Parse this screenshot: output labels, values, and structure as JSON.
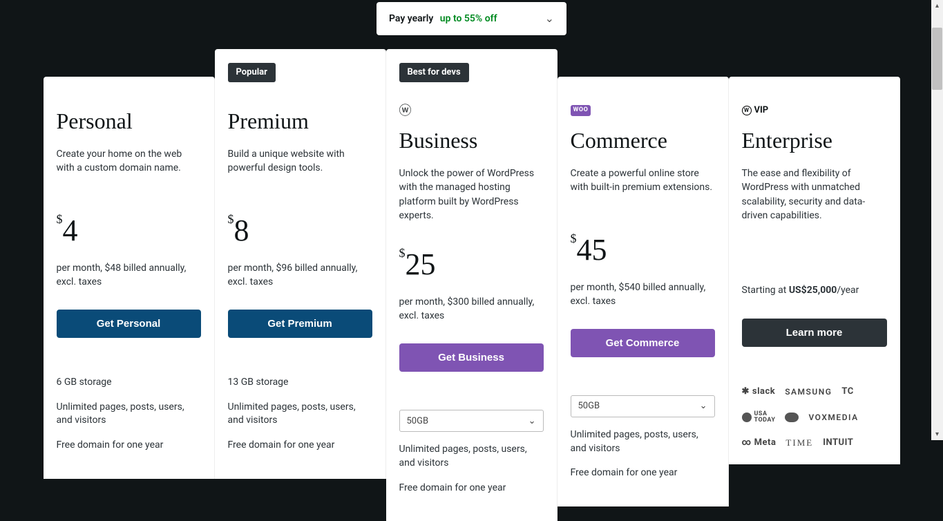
{
  "billing": {
    "label": "Pay yearly",
    "promo": "up to 55% off"
  },
  "plans": [
    {
      "title": "Personal",
      "desc": "Create your home on the web with a custom domain name.",
      "price": "4",
      "billing_note": "per month, $48 billed annually, excl. taxes",
      "button": "Get Personal",
      "features": [
        "6 GB storage",
        "Unlimited pages, posts, users, and visitors",
        "Free domain for one year"
      ]
    },
    {
      "badge": "Popular",
      "title": "Premium",
      "desc": "Build a unique website with powerful design tools.",
      "price": "8",
      "billing_note": "per month, $96 billed annually, excl. taxes",
      "button": "Get Premium",
      "features": [
        "13 GB storage",
        "Unlimited pages, posts, users, and visitors",
        "Free domain for one year"
      ]
    },
    {
      "badge": "Best for devs",
      "title": "Business",
      "desc": "Unlock the power of WordPress with the managed hosting platform built by WordPress experts.",
      "price": "25",
      "billing_note": "per month, $300 billed annually, excl. taxes",
      "button": "Get Business",
      "storage": "50GB",
      "features": [
        "Unlimited pages, posts, users, and visitors",
        "Free domain for one year"
      ]
    },
    {
      "title": "Commerce",
      "desc": "Create a powerful online store with built-in premium extensions.",
      "price": "45",
      "billing_note": "per month, $540 billed annually, excl. taxes",
      "button": "Get Commerce",
      "storage": "50GB",
      "features": [
        "Unlimited pages, posts, users, and visitors",
        "Free domain for one year"
      ]
    },
    {
      "title": "Enterprise",
      "desc": "The ease and flexibility of WordPress with unmatched scalability, security and data-driven capabilities.",
      "starting_prefix": "Starting at ",
      "starting_bold": "US$25,000",
      "starting_suffix": "/year",
      "button": "Learn more",
      "clients": [
        "slack",
        "SAMSUNG",
        "TC",
        "USA TODAY",
        "salesforce",
        "VOXMEDIA",
        "Meta",
        "TIME",
        "INTUIT"
      ]
    }
  ]
}
